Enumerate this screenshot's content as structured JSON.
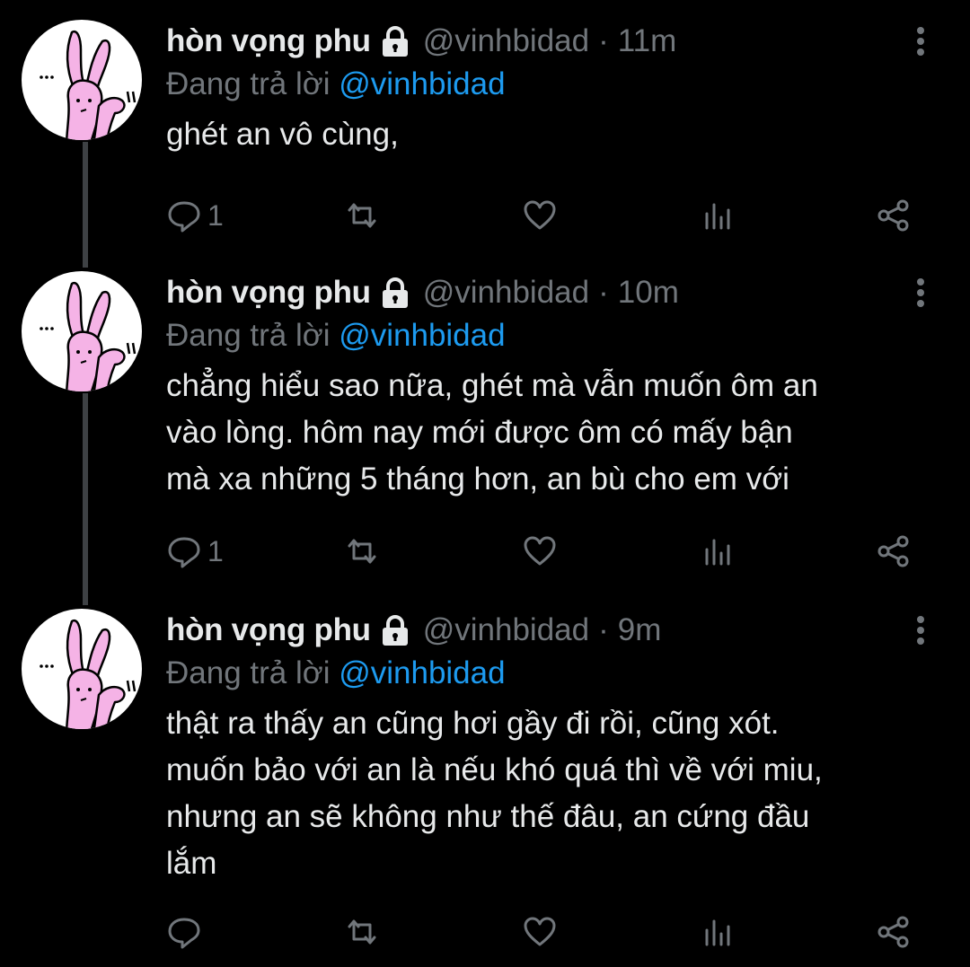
{
  "tweets": [
    {
      "display_name": "hòn vọng phu",
      "handle": "@vinhbidad",
      "separator": "·",
      "time": "11m",
      "reply_prefix": "Đang trả lời",
      "reply_to": "@vinhbidad",
      "text_lines": [
        "ghét an vô cùng,"
      ],
      "reply_count": "1",
      "retweet_count": "",
      "like_count": ""
    },
    {
      "display_name": "hòn vọng phu",
      "handle": "@vinhbidad",
      "separator": "·",
      "time": "10m",
      "reply_prefix": "Đang trả lời",
      "reply_to": "@vinhbidad",
      "text_lines": [
        "chẳng hiểu sao nữa, ghét mà vẫn muốn ôm an",
        "vào lòng. hôm nay mới được ôm có mấy bận",
        "mà xa những 5 tháng hơn, an bù cho em với"
      ],
      "reply_count": "1",
      "retweet_count": "",
      "like_count": ""
    },
    {
      "display_name": "hòn vọng phu",
      "handle": "@vinhbidad",
      "separator": "·",
      "time": "9m",
      "reply_prefix": "Đang trả lời",
      "reply_to": "@vinhbidad",
      "text_lines": [
        "thật ra thấy an cũng hơi gầy đi rồi, cũng xót.",
        "muốn bảo với an là nếu khó quá thì về với miu,",
        "nhưng an sẽ không như thế đâu, an cứng đầu",
        "lắm"
      ],
      "reply_count": "",
      "retweet_count": "",
      "like_count": ""
    }
  ],
  "icons": {
    "lock": "lock-icon",
    "more": "more-vertical-icon",
    "reply": "reply-icon",
    "retweet": "retweet-icon",
    "like": "heart-icon",
    "views": "views-icon",
    "share": "share-icon"
  },
  "colors": {
    "background": "#000000",
    "text": "#e7e9ea",
    "muted": "#71767b",
    "link": "#1d9bf0",
    "thread_line": "#3e4144",
    "avatar_pink": "#f5b3e6"
  }
}
